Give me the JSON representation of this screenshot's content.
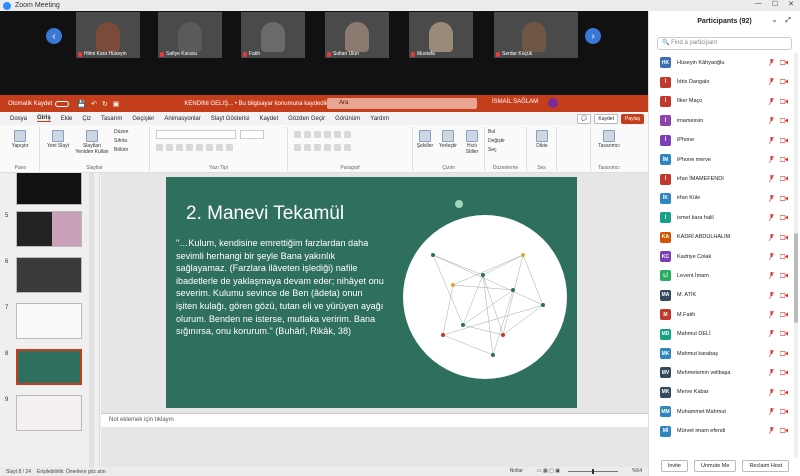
{
  "zoom": {
    "title": "Zoom Meeting",
    "participants": [
      {
        "name": "Hilmi Kara Hüseyin",
        "bg": "#7a4b3a"
      },
      {
        "name": "Safiye Karasu",
        "bg": "#5a5a5a"
      },
      {
        "name": "Fatih",
        "bg": "#6a6a6a"
      },
      {
        "name": "Sultan Ulun",
        "bg": "#8a7a70"
      },
      {
        "name": "Mustafa",
        "bg": "#9a8a7a"
      },
      {
        "name": "Serdar Küçük",
        "bg": "#a7a294"
      }
    ]
  },
  "ppt": {
    "autosave_label": "Otomatik Kaydet",
    "doc_title": "KENDINI GELIŞ... • Bu bilgisayar konumuna kaydedildi",
    "search_text": "Ara",
    "user_name": "İSMAİL SAĞLAM",
    "tabs": [
      "Dosya",
      "Giriş",
      "Ekle",
      "Çiz",
      "Tasarım",
      "Geçişler",
      "Animasyonlar",
      "Slayt Gösterisi",
      "Kaydet",
      "Gözden Geçir",
      "Görünüm",
      "Yardım"
    ],
    "active_tab": "Giriş",
    "record_label": "Kaydet",
    "share_label": "Paylaş",
    "ribbon": {
      "paste": "Yapıştır",
      "new_slide": "Yeni Slayt",
      "reuse": "Slaytları Yeniden Kullan",
      "layout": "Düzen",
      "reset": "Sıfırla",
      "section": "Bölüm",
      "shapes": "Şekiller",
      "arrange": "Yerleştir",
      "quick_styles": "Hızlı Stiller",
      "find": "Bul",
      "replace": "Değiştir",
      "select": "Seç",
      "dictate": "Dikte",
      "designer": "Tasarımcı",
      "group_clipboard": "Pano",
      "group_slides": "Slaytlar",
      "group_font": "Yazı Tipi",
      "group_paragraph": "Paragraf",
      "group_drawing": "Çizim",
      "group_editing": "Düzenleme",
      "group_voice": "Ses",
      "group_designer": "Tasarımcı"
    },
    "thumbnails": [
      "5",
      "6",
      "7",
      "8",
      "9"
    ],
    "slide": {
      "title": "2. Manevi Tekamül",
      "body": "\"…Kulum, kendisine emrettiğim farzlardan daha sevimli herhangi bir şeyle Bana yakınlık sağlayamaz. (Farzlara ilâveten işlediği) nafile ibadetlerle de yaklaşmaya devam eder; nihâyet onu severim. Kulumu sevince de Ben (âdeta) onun işiten kulağı, gören gözü, tutan eli ve yürüyen ayağı olurum. Benden ne isterse, mutlaka veririm. Bana sığınırsa, onu korurum.\" (Buhârî, Rikâk, 38)"
    },
    "notes_placeholder": "Not eklemek için tıklayın",
    "status": {
      "slide_count": "Slayt 8 / 24",
      "accessibility": "Erişilebilirlik: Önerilere göz atın",
      "notes": "Notlar",
      "zoom": "%64"
    }
  },
  "panel": {
    "title": "Participants (92)",
    "search_placeholder": "Find a participant",
    "participants": [
      {
        "initials": "HK",
        "name": "Hüseyin Kâhyaoğlu",
        "color": "#3b6fb6"
      },
      {
        "initials": "İ",
        "name": "İdris Dangalo",
        "color": "#c0392b"
      },
      {
        "initials": "İ",
        "name": "İlker Maço",
        "color": "#c0392b"
      },
      {
        "initials": "İ",
        "name": "imamessin",
        "color": "#8e44ad"
      },
      {
        "initials": "İ",
        "name": "iPhone",
        "color": "#7b3fb6"
      },
      {
        "initials": "İM",
        "name": "iPhone merve",
        "color": "#2e86c1"
      },
      {
        "initials": "İ",
        "name": "irfan İMAMEFENDI",
        "color": "#c0392b"
      },
      {
        "initials": "İK",
        "name": "irfan Küle",
        "color": "#2e86c1"
      },
      {
        "initials": "İ",
        "name": "ismet kara halil",
        "color": "#16a085"
      },
      {
        "initials": "KA",
        "name": "KADRİ ABDULHALIM",
        "color": "#d35400"
      },
      {
        "initials": "KC",
        "name": "Kadriye Colak",
        "color": "#7b3fb6"
      },
      {
        "initials": "Lİ",
        "name": "Levent İmam",
        "color": "#27ae60"
      },
      {
        "initials": "MA",
        "name": "M. ATİK",
        "color": "#34495e"
      },
      {
        "initials": "M",
        "name": "M.Fatih",
        "color": "#c0392b"
      },
      {
        "initials": "MD",
        "name": "Mahmut DELİ",
        "color": "#16a085"
      },
      {
        "initials": "MK",
        "name": "Mahmut karabaş",
        "color": "#2e86c1"
      },
      {
        "initials": "MV",
        "name": "Mehmetemin velibaşa",
        "color": "#34495e"
      },
      {
        "initials": "MK",
        "name": "Merve Kabar",
        "color": "#34495e"
      },
      {
        "initials": "MM",
        "name": "Muhammet Mahmut",
        "color": "#2e86c1"
      },
      {
        "initials": "Mİ",
        "name": "Mürvet imam efendi",
        "color": "#2e86c1"
      }
    ],
    "invite_label": "Invite",
    "unmute_label": "Unmute Me",
    "claim_host_label": "Reclaim Host"
  }
}
